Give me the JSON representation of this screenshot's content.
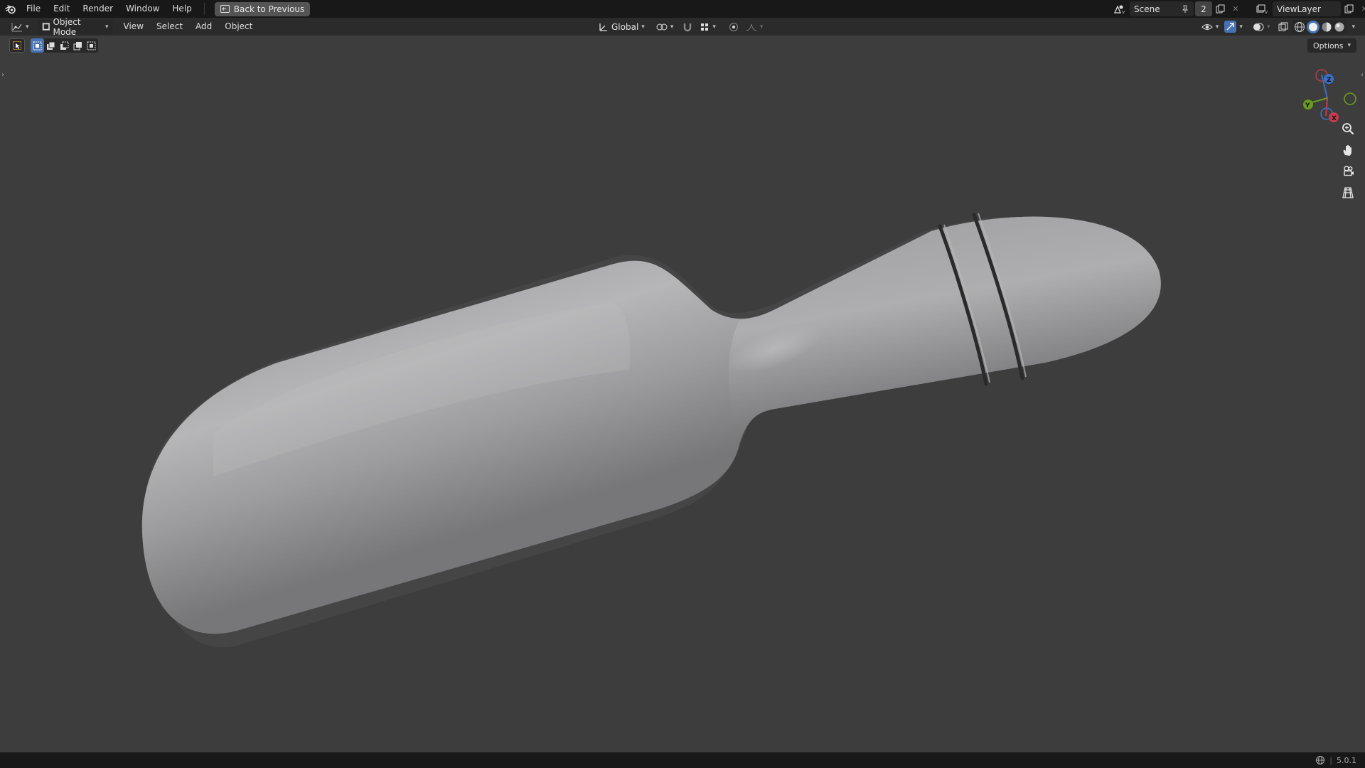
{
  "menu": {
    "items": [
      "File",
      "Edit",
      "Render",
      "Window",
      "Help"
    ],
    "back_button": "Back to Previous"
  },
  "scene": {
    "name": "Scene",
    "count": "2",
    "view_layer": "ViewLayer"
  },
  "header": {
    "mode": "Object Mode",
    "menus": [
      "View",
      "Select",
      "Add",
      "Object"
    ],
    "orientation": "Global"
  },
  "toolrow": {
    "options_label": "Options"
  },
  "gizmo": {
    "axis_x": "X",
    "axis_y": "Y",
    "axis_z": "Z"
  },
  "statusbar": {
    "version": "5.0.1"
  },
  "colors": {
    "accent": "#4772b3",
    "axis_x": "#c83c4f",
    "axis_y": "#6a9a1f",
    "axis_z": "#3a6fc2"
  }
}
